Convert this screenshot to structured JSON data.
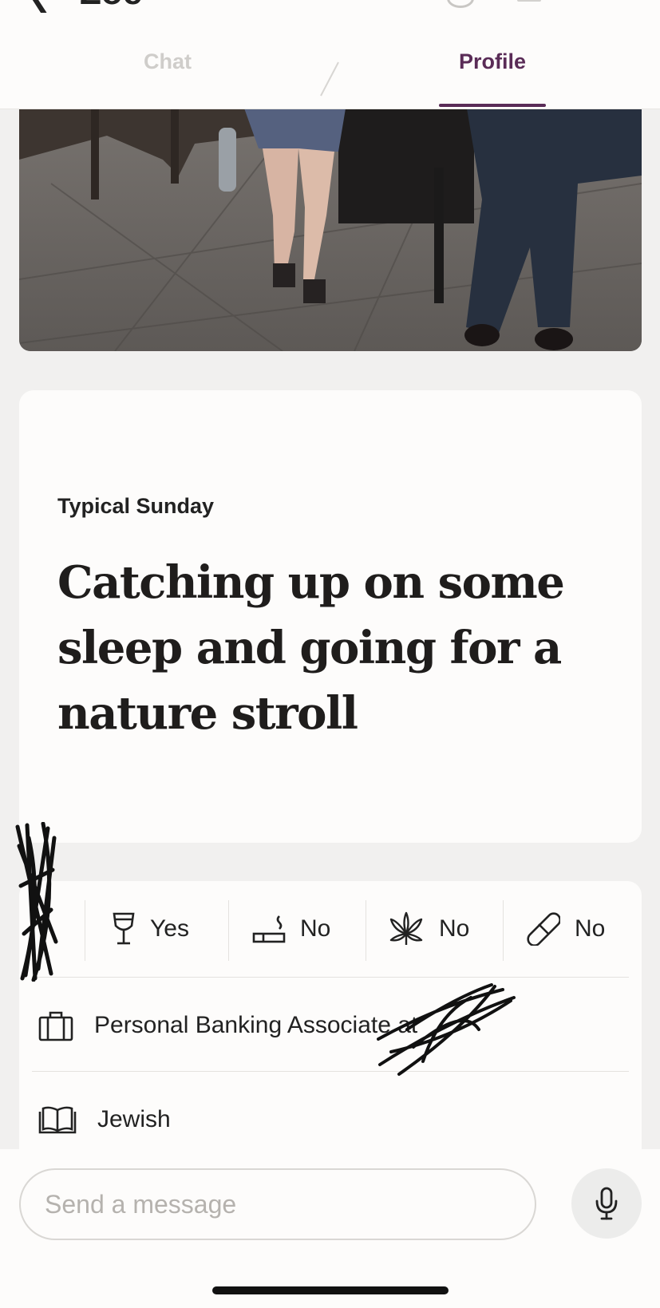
{
  "header": {
    "back_icon": "chevron-left-icon",
    "name_partial": "Zoe",
    "tabs": [
      {
        "label": "Chat",
        "active": false
      },
      {
        "label": "Profile",
        "active": true
      }
    ]
  },
  "photo": {
    "description_icon": "profile-photo"
  },
  "prompt": {
    "question": "Typical Sunday",
    "answer": "Catching up on some sleep and going for a nature stroll"
  },
  "vitals": {
    "items": [
      {
        "icon": "wine-glass-icon",
        "label": "Yes"
      },
      {
        "icon": "cigarette-icon",
        "label": "No"
      },
      {
        "icon": "cannabis-leaf-icon",
        "label": "No"
      },
      {
        "icon": "pill-icon",
        "label": "No"
      }
    ],
    "job": {
      "icon": "briefcase-icon",
      "label": "Personal Banking Associate at"
    },
    "religion": {
      "icon": "book-icon",
      "label": "Jewish"
    }
  },
  "composer": {
    "placeholder": "Send a message",
    "mic_icon": "microphone-icon"
  },
  "colors": {
    "accent": "#5a2c57",
    "card_bg": "#fdfcfb",
    "page_bg": "#f1f0ef"
  }
}
